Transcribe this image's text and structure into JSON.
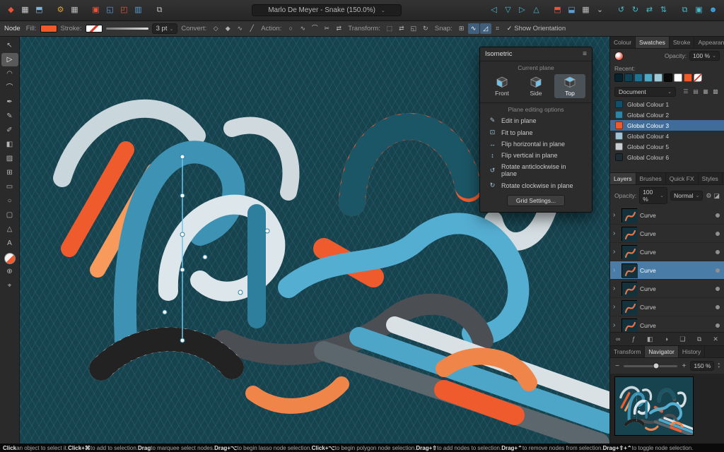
{
  "ui": {
    "dropdown_chevron": "⌄",
    "checkmark": "✓",
    "menu_icon": "≡"
  },
  "titlebar": {
    "document_title": "Marlo De Meyer - Snake (150.0%)",
    "left_icons": [
      {
        "name": "designer-persona-icon",
        "glyph": "◆",
        "color": "#e8543a"
      },
      {
        "name": "pixel-persona-icon",
        "glyph": "▦",
        "color": "#cfcfcf"
      },
      {
        "name": "export-persona-icon",
        "glyph": "⬒",
        "color": "#7fb4d8"
      },
      {
        "name": "separator"
      },
      {
        "name": "settings-gear-icon",
        "glyph": "⚙",
        "color": "#e0a33a"
      },
      {
        "name": "grid-toggle-icon",
        "glyph": "▦",
        "color": "#bdbdbd"
      },
      {
        "name": "separator"
      },
      {
        "name": "insert-inside-icon",
        "glyph": "▣",
        "color": "#e8543a"
      },
      {
        "name": "insert-behind-icon",
        "glyph": "◱",
        "color": "#5a9fd8"
      },
      {
        "name": "insert-front-icon",
        "glyph": "◰",
        "color": "#e8543a"
      },
      {
        "name": "insert-on-top-icon",
        "glyph": "▥",
        "color": "#5a9fd8"
      },
      {
        "name": "separator"
      },
      {
        "name": "snapshot-icon",
        "glyph": "⧉",
        "color": "#bdbdbd"
      }
    ],
    "right_icons": [
      {
        "name": "align-left-icon",
        "glyph": "◁",
        "color": "#49b8c8"
      },
      {
        "name": "align-centre-icon",
        "glyph": "▽",
        "color": "#49b8c8"
      },
      {
        "name": "align-right-icon",
        "glyph": "▷",
        "color": "#49b8c8"
      },
      {
        "name": "distribute-icon",
        "glyph": "△",
        "color": "#49b8c8"
      },
      {
        "name": "separator"
      },
      {
        "name": "order-front-icon",
        "glyph": "⬒",
        "color": "#e8543a"
      },
      {
        "name": "order-back-icon",
        "glyph": "⬓",
        "color": "#5a9fd8"
      },
      {
        "name": "transparency-grid-icon",
        "glyph": "▦",
        "color": "#bdbdbd"
      },
      {
        "name": "zoom-preset-icon",
        "glyph": "⌄",
        "color": "#bdbdbd"
      },
      {
        "name": "separator"
      },
      {
        "name": "rotate-anticlockwise-icon",
        "glyph": "↺",
        "color": "#49b8c8"
      },
      {
        "name": "rotate-clockwise-icon",
        "glyph": "↻",
        "color": "#49b8c8"
      },
      {
        "name": "flip-horizontal-icon",
        "glyph": "⇄",
        "color": "#49b8c8"
      },
      {
        "name": "flip-vertical-icon",
        "glyph": "⇅",
        "color": "#49b8c8"
      },
      {
        "name": "separator"
      },
      {
        "name": "duplicate-icon",
        "glyph": "⧉",
        "color": "#49b8c8"
      },
      {
        "name": "group-icon",
        "glyph": "▣",
        "color": "#49b8c8"
      },
      {
        "name": "account-icon",
        "glyph": "☻",
        "color": "#3fa7e8"
      }
    ]
  },
  "context_toolbar": {
    "tool_label": "Node",
    "fill_label": "Fill:",
    "fill_color": "#f05a2b",
    "stroke_label": "Stroke:",
    "stroke_width": "3 pt",
    "convert_label": "Convert:",
    "convert_icons": [
      {
        "name": "convert-sharp-node-icon",
        "glyph": "◇"
      },
      {
        "name": "convert-smooth-node-icon",
        "glyph": "◆"
      },
      {
        "name": "convert-smart-node-icon",
        "glyph": "∿"
      },
      {
        "name": "convert-line-icon",
        "glyph": "╱"
      }
    ],
    "action_label": "Action:",
    "action_icons": [
      {
        "name": "close-curve-icon",
        "glyph": "○"
      },
      {
        "name": "smooth-curve-icon",
        "glyph": "∿"
      },
      {
        "name": "join-curves-icon",
        "glyph": "⌒"
      },
      {
        "name": "break-curve-icon",
        "glyph": "✂"
      },
      {
        "name": "reverse-curve-icon",
        "glyph": "⇄"
      }
    ],
    "transform_label": "Transform:",
    "transform_icons": [
      {
        "name": "transform-mode-icon",
        "glyph": "⬚"
      },
      {
        "name": "transform-mirror-icon",
        "glyph": "⇄"
      },
      {
        "name": "transform-scale-icon",
        "glyph": "◱"
      },
      {
        "name": "transform-rotate-icon",
        "glyph": "↻"
      }
    ],
    "snap_label": "Snap:",
    "snap_icons": [
      {
        "name": "snap-to-grid-icon",
        "glyph": "⊞",
        "active": false
      },
      {
        "name": "snap-to-curves-icon",
        "glyph": "∿",
        "active": true
      },
      {
        "name": "snap-construction-icon",
        "glyph": "◿",
        "active": true
      },
      {
        "name": "snap-alignment-icon",
        "glyph": "⌗",
        "active": false
      }
    ],
    "show_orientation_label": "Show Orientation"
  },
  "tools": [
    {
      "name": "move-tool",
      "glyph": "↖"
    },
    {
      "name": "node-tool",
      "glyph": "▷",
      "selected": true
    },
    {
      "name": "contour-tool",
      "glyph": "◠"
    },
    {
      "name": "corner-tool",
      "glyph": "⌒"
    },
    {
      "name": "pen-tool",
      "glyph": "✒"
    },
    {
      "name": "pencil-tool",
      "glyph": "✎"
    },
    {
      "name": "brush-tool",
      "glyph": "✐"
    },
    {
      "name": "fill-tool",
      "glyph": "◧"
    },
    {
      "name": "transparency-tool",
      "glyph": "▨"
    },
    {
      "name": "crop-tool",
      "glyph": "⊞"
    },
    {
      "name": "rectangle-tool",
      "glyph": "▭"
    },
    {
      "name": "ellipse-tool",
      "glyph": "○"
    },
    {
      "name": "rounded-rectangle-tool",
      "glyph": "▢"
    },
    {
      "name": "shape-tool",
      "glyph": "△"
    },
    {
      "name": "text-tool",
      "glyph": "A"
    },
    {
      "name": "colour-selector",
      "type": "colour"
    },
    {
      "name": "zoom-tool",
      "glyph": "⊕"
    },
    {
      "name": "view-tool",
      "glyph": "⌖"
    }
  ],
  "isometric_panel": {
    "title": "Isometric",
    "current_plane_label": "Current plane",
    "planes": [
      {
        "label": "Front",
        "selected": false
      },
      {
        "label": "Side",
        "selected": false
      },
      {
        "label": "Top",
        "selected": true
      }
    ],
    "editing_options_label": "Plane editing options",
    "options": [
      {
        "name": "edit-in-plane-option",
        "glyph": "✎",
        "label": "Edit in plane"
      },
      {
        "name": "fit-to-plane-option",
        "glyph": "⊡",
        "label": "Fit to plane"
      },
      {
        "name": "flip-horizontal-in-plane-option",
        "glyph": "↔",
        "label": "Flip horizontal in plane"
      },
      {
        "name": "flip-vertical-in-plane-option",
        "glyph": "↕",
        "label": "Flip vertical in plane"
      },
      {
        "name": "rotate-anticlockwise-in-plane-option",
        "glyph": "↺",
        "label": "Rotate anticlockwise in plane"
      },
      {
        "name": "rotate-clockwise-in-plane-option",
        "glyph": "↻",
        "label": "Rotate clockwise in plane"
      }
    ],
    "grid_settings_label": "Grid Settings..."
  },
  "swatches_panel": {
    "tabs": [
      {
        "label": "Colour",
        "active": false
      },
      {
        "label": "Swatches",
        "active": true
      },
      {
        "label": "Stroke",
        "active": false
      },
      {
        "label": "Appearance",
        "active": false
      }
    ],
    "opacity_label": "Opacity:",
    "opacity_value": "100 %",
    "recent_label": "Recent:",
    "recent_swatches": [
      "#08222e",
      "#0f4254",
      "#1f7291",
      "#4fa8c6",
      "#9fcbd8",
      "#0a0a0a",
      "#ffffff",
      "#f05a2b"
    ],
    "category_value": "Document",
    "view_icons": [
      {
        "name": "list-view-icon",
        "glyph": "☰"
      },
      {
        "name": "grid-view-small-icon",
        "glyph": "▤"
      },
      {
        "name": "grid-view-medium-icon",
        "glyph": "▦"
      },
      {
        "name": "grid-view-large-icon",
        "glyph": "▩"
      }
    ],
    "global_colours": [
      {
        "label": "Global Colour 1",
        "color": "#11506b",
        "selected": false
      },
      {
        "label": "Global Colour 2",
        "color": "#2e84a6",
        "selected": false
      },
      {
        "label": "Global Colour 3",
        "color": "#f05a2b",
        "selected": true
      },
      {
        "label": "Global Colour 4",
        "color": "#9fc4d4",
        "selected": false
      },
      {
        "label": "Global Colour 5",
        "color": "#caced1",
        "selected": false
      },
      {
        "label": "Global Colour 6",
        "color": "#1d2b33",
        "selected": false
      }
    ]
  },
  "layers_panel": {
    "tabs": [
      {
        "label": "Layers",
        "active": true
      },
      {
        "label": "Brushes",
        "active": false
      },
      {
        "label": "Quick FX",
        "active": false
      },
      {
        "label": "Styles",
        "active": false
      }
    ],
    "opacity_label": "Opacity:",
    "opacity_value": "100 %",
    "blend_mode": "Normal",
    "header_icons": [
      {
        "name": "blend-options-gear-icon",
        "glyph": "⚙"
      },
      {
        "name": "lock-icon",
        "glyph": "◪"
      }
    ],
    "layers": [
      {
        "label": "Curve",
        "selected": false
      },
      {
        "label": "Curve",
        "selected": false
      },
      {
        "label": "Curve",
        "selected": false
      },
      {
        "label": "Curve",
        "selected": true
      },
      {
        "label": "Curve",
        "selected": false
      },
      {
        "label": "Curve",
        "selected": false
      },
      {
        "label": "Curve",
        "selected": false
      }
    ],
    "footer_icons": [
      {
        "name": "link-icon",
        "glyph": "∞"
      },
      {
        "name": "fx-icon",
        "glyph": "ƒ"
      },
      {
        "name": "mask-icon",
        "glyph": "◧"
      },
      {
        "name": "adjustment-icon",
        "glyph": "◑"
      },
      {
        "name": "new-layer-icon",
        "glyph": "❏"
      },
      {
        "name": "new-group-icon",
        "glyph": "⧉"
      },
      {
        "name": "delete-icon",
        "glyph": "✕"
      }
    ]
  },
  "navigator_panel": {
    "tabs": [
      {
        "label": "Transform",
        "active": false
      },
      {
        "label": "Navigator",
        "active": true
      },
      {
        "label": "History",
        "active": false
      }
    ],
    "zoom_out_label": "−",
    "zoom_in_label": "+",
    "zoom_value": "150 %",
    "stepper_up": "▴",
    "stepper_down": "▾"
  },
  "canvas": {
    "background": "#17434f",
    "palette": [
      "#ef5b2d",
      "#f79a5c",
      "#3e93b5",
      "#54aed2",
      "#dde6ea",
      "#4b4e52"
    ]
  },
  "status_bar": {
    "segments": [
      {
        "text": "Click",
        "bold": true
      },
      {
        "text": " an object to select it. ",
        "bold": false
      },
      {
        "text": "Click+⌘",
        "bold": true
      },
      {
        "text": " to add to selection. ",
        "bold": false
      },
      {
        "text": "Drag",
        "bold": true
      },
      {
        "text": " to marquee select nodes. ",
        "bold": false
      },
      {
        "text": "Drag+⌥",
        "bold": true
      },
      {
        "text": " to begin lasso node selection. ",
        "bold": false
      },
      {
        "text": "Click+⌥",
        "bold": true
      },
      {
        "text": " to begin polygon node selection. ",
        "bold": false
      },
      {
        "text": "Drag+⇧",
        "bold": true
      },
      {
        "text": " to add nodes to selection. ",
        "bold": false
      },
      {
        "text": "Drag+⌃",
        "bold": true
      },
      {
        "text": " to remove nodes from selection. ",
        "bold": false
      },
      {
        "text": "Drag+⇧+⌃",
        "bold": true
      },
      {
        "text": " to toggle node selection.",
        "bold": false
      }
    ]
  }
}
